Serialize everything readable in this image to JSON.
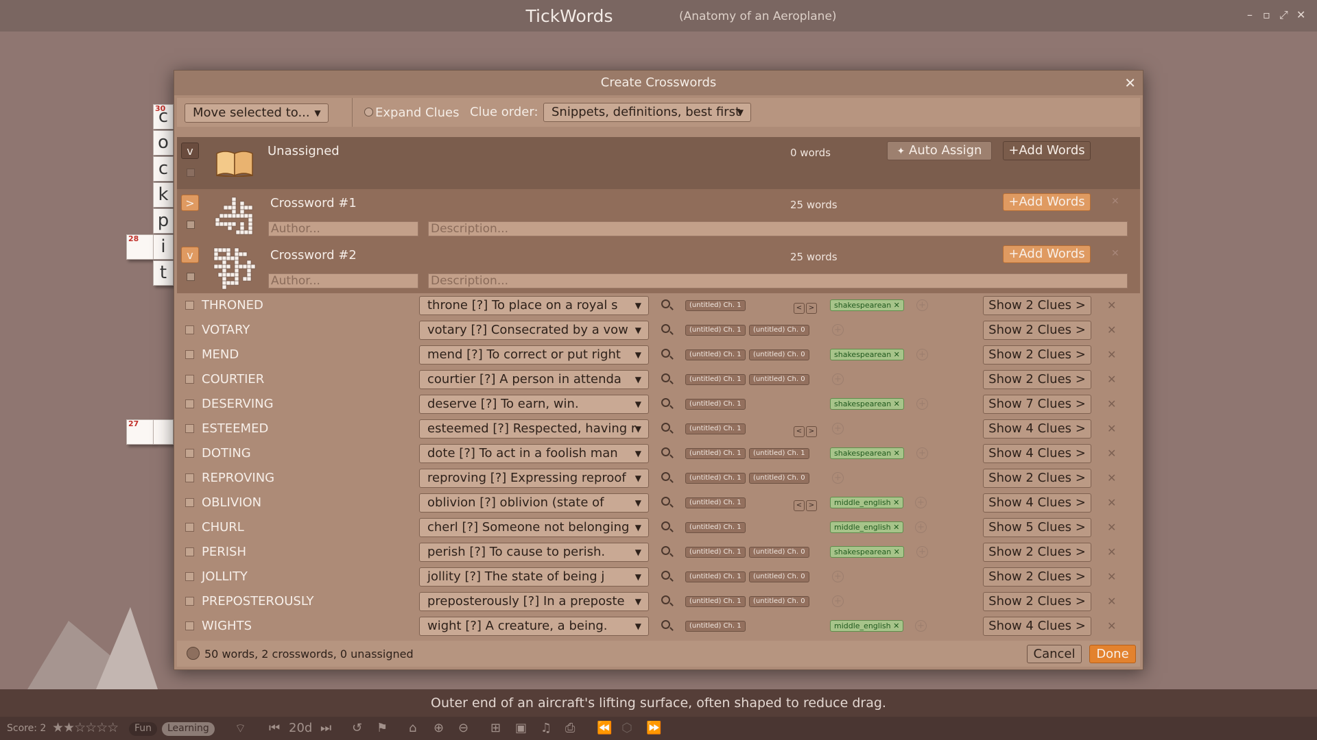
{
  "window": {
    "app_title": "TickWords",
    "doc_title": "(Anatomy of an Aeroplane)",
    "controls": [
      "–",
      "▫",
      "⤢",
      "✕"
    ]
  },
  "background_grid": {
    "letters": [
      "c",
      "o",
      "c",
      "k",
      "p",
      "i",
      "t"
    ],
    "numbers": [
      "30",
      "28",
      "27"
    ]
  },
  "dialog": {
    "title": "Create Crosswords",
    "close": "✕",
    "toolbar": {
      "move_selected": "Move selected to...",
      "expand_clues": "Expand Clues",
      "clue_order_label": "Clue order:",
      "clue_order_value": "Snippets, definitions, best first"
    },
    "groups": [
      {
        "toggle": "v",
        "name": "Unassigned",
        "count": "0 words",
        "auto_assign": "Auto Assign",
        "add_words": "+Add Words"
      },
      {
        "toggle": ">",
        "name": "Crossword #1",
        "count": "25 words",
        "add_words": "+Add Words",
        "author_placeholder": "Author...",
        "description_placeholder": "Description..."
      },
      {
        "toggle": "v",
        "name": "Crossword #2",
        "count": "25 words",
        "add_words": "+Add Words",
        "author_placeholder": "Author...",
        "description_placeholder": "Description..."
      }
    ],
    "rows": [
      {
        "word": "THRONED",
        "clue": "throne [?] To place on a royal s",
        "sources": [
          "(untitled) Ch. 1"
        ],
        "arrows": true,
        "tag": "shakespearean",
        "clues_btn": "Show 2 Clues >"
      },
      {
        "word": "VOTARY",
        "clue": "votary [?] Consecrated by a vow",
        "sources": [
          "(untitled) Ch. 1",
          "(untitled) Ch. 0"
        ],
        "arrows": false,
        "tag": "",
        "clues_btn": "Show 2 Clues >"
      },
      {
        "word": "MEND",
        "clue": "mend [?] To correct or put right",
        "sources": [
          "(untitled) Ch. 1",
          "(untitled) Ch. 0"
        ],
        "arrows": false,
        "tag": "shakespearean",
        "clues_btn": "Show 2 Clues >"
      },
      {
        "word": "COURTIER",
        "clue": "courtier [?] A person in attenda",
        "sources": [
          "(untitled) Ch. 1",
          "(untitled) Ch. 0"
        ],
        "arrows": false,
        "tag": "",
        "clues_btn": "Show 2 Clues >"
      },
      {
        "word": "DESERVING",
        "clue": "deserve [?] To earn, win.",
        "sources": [
          "(untitled) Ch. 1"
        ],
        "arrows": false,
        "tag": "shakespearean",
        "clues_btn": "Show 7 Clues >"
      },
      {
        "word": "ESTEEMED",
        "clue": "esteemed [?] Respected, having r",
        "sources": [
          "(untitled) Ch. 1"
        ],
        "arrows": true,
        "tag": "",
        "clues_btn": "Show 4 Clues >"
      },
      {
        "word": "DOTING",
        "clue": "dote [?] To act in a foolish man",
        "sources": [
          "(untitled) Ch. 1",
          "(untitled) Ch. 1"
        ],
        "arrows": false,
        "tag": "shakespearean",
        "clues_btn": "Show 4 Clues >"
      },
      {
        "word": "REPROVING",
        "clue": "reproving [?] Expressing reproof",
        "sources": [
          "(untitled) Ch. 1",
          "(untitled) Ch. 0"
        ],
        "arrows": false,
        "tag": "",
        "clues_btn": "Show 2 Clues >"
      },
      {
        "word": "OBLIVION",
        "clue": "oblivion [?] oblivion (state of",
        "sources": [
          "(untitled) Ch. 1"
        ],
        "arrows": true,
        "tag": "middle_english",
        "clues_btn": "Show 4 Clues >"
      },
      {
        "word": "CHURL",
        "clue": "cherl [?] Someone not belonging",
        "sources": [
          "(untitled) Ch. 1"
        ],
        "arrows": false,
        "tag": "middle_english",
        "clues_btn": "Show 5 Clues >"
      },
      {
        "word": "PERISH",
        "clue": "perish [?] To cause to perish.",
        "sources": [
          "(untitled) Ch. 1",
          "(untitled) Ch. 0"
        ],
        "arrows": false,
        "tag": "shakespearean",
        "clues_btn": "Show 2 Clues >"
      },
      {
        "word": "JOLLITY",
        "clue": "jollity [?] The state of being j",
        "sources": [
          "(untitled) Ch. 1",
          "(untitled) Ch. 0"
        ],
        "arrows": false,
        "tag": "",
        "clues_btn": "Show 2 Clues >"
      },
      {
        "word": "PREPOSTEROUSLY",
        "clue": "preposterously [?] In a preposte",
        "sources": [
          "(untitled) Ch. 1",
          "(untitled) Ch. 0"
        ],
        "arrows": false,
        "tag": "",
        "clues_btn": "Show 2 Clues >"
      },
      {
        "word": "WIGHTS",
        "clue": "wight [?] A creature, a being.",
        "sources": [
          "(untitled) Ch. 1"
        ],
        "arrows": false,
        "tag": "middle_english",
        "clues_btn": "Show 4 Clues >"
      }
    ],
    "footer": {
      "summary": "50 words, 2 crosswords, 0 unassigned",
      "cancel": "Cancel",
      "done": "Done"
    }
  },
  "clue_bar": "Outer end of an aircraft's lifting surface, often shaped to reduce drag.",
  "bottom_bar": {
    "score": "Score: 2",
    "stars": "★★☆☆☆☆",
    "rating": 2,
    "mode_fun": "Fun",
    "mode_learning": "Learning",
    "days": "20d"
  },
  "colors": {
    "accent_orange": "#e3822e",
    "tag_green": "#a7c48a",
    "dialog_bg": "#ad8b77"
  }
}
